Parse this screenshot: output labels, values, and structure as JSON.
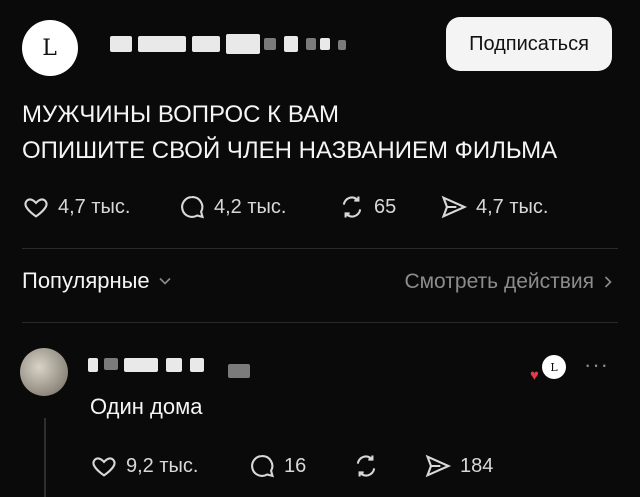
{
  "post": {
    "author_avatar_text": "L",
    "subscribe_label": "Подписаться",
    "text_lines": [
      "МУЖЧИНЫ ВОПРОС К ВАМ",
      "ОПИШИТЕ СВОЙ ЧЛЕН НАЗВАНИЕМ ФИЛЬМА"
    ],
    "likes": "4,7 тыс.",
    "comments": "4,2 тыс.",
    "reposts": "65",
    "shares": "4,7 тыс."
  },
  "replies_header": {
    "sort_label": "Популярные",
    "activity_label": "Смотреть действия"
  },
  "comment": {
    "text": "Один дома",
    "likes": "9,2 тыс.",
    "comments": "16",
    "shares": "184",
    "badge_text": "L"
  },
  "colors": {
    "background": "#0a0a0a",
    "text": "#f2f2f2",
    "muted": "#8c8c8c",
    "heart": "#e23a4a"
  },
  "icons": [
    "heart-icon",
    "comment-icon",
    "repost-icon",
    "share-icon",
    "chevron-down-icon",
    "chevron-right-icon",
    "more-icon"
  ]
}
